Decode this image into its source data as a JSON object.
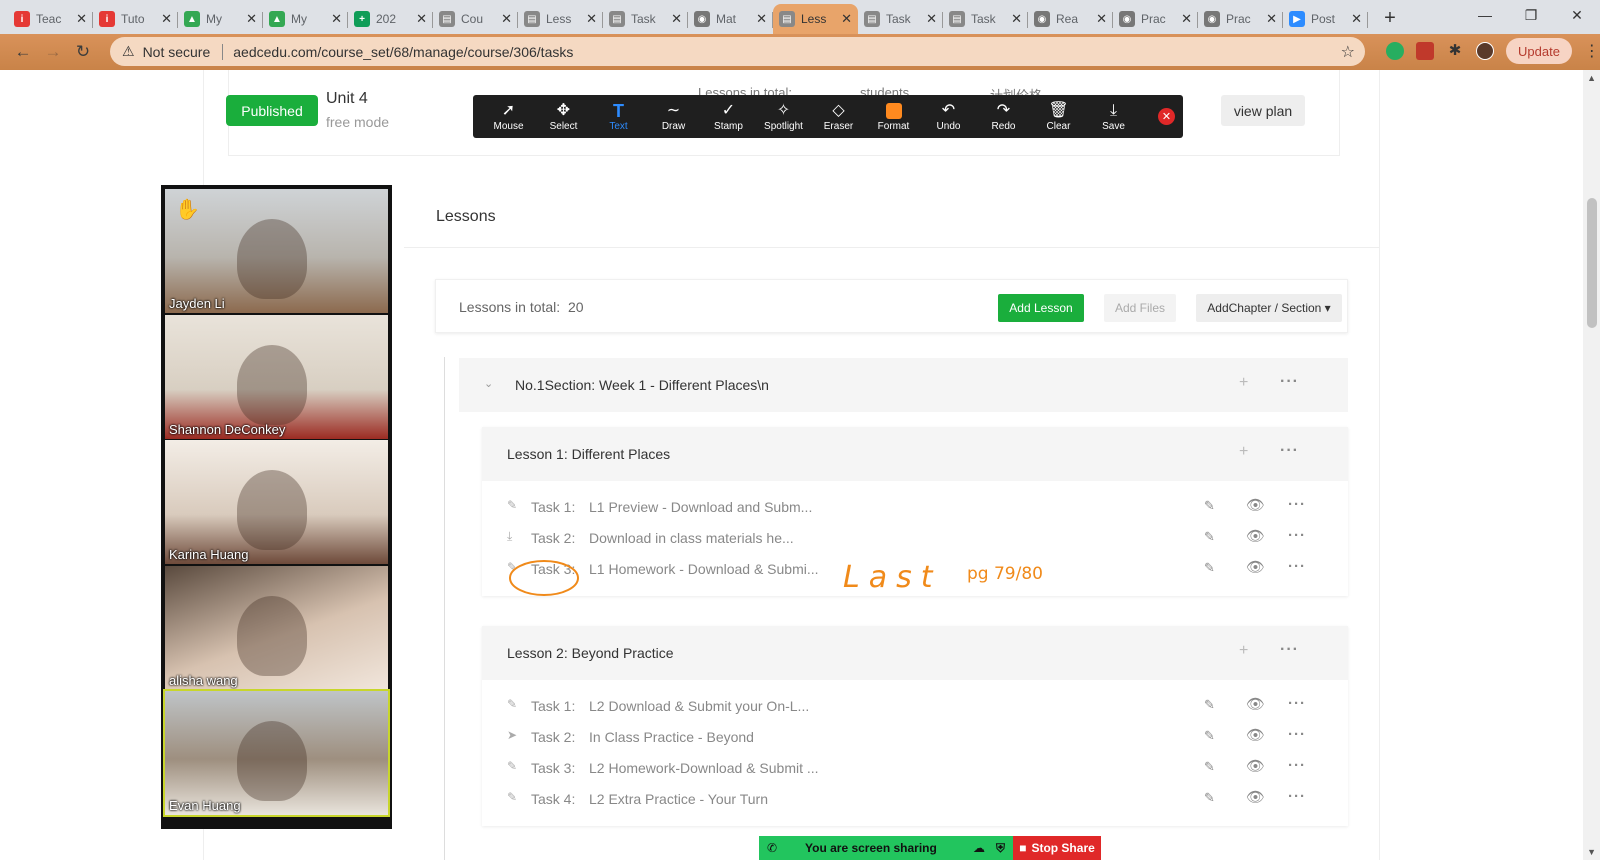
{
  "browser": {
    "tabs": [
      {
        "title": "Teac",
        "icon": "red-i-icon",
        "color": "#e53935"
      },
      {
        "title": "Tuto",
        "icon": "red-i-icon",
        "color": "#e53935"
      },
      {
        "title": "My",
        "icon": "google-drive-icon",
        "color": "#34a853"
      },
      {
        "title": "My",
        "icon": "google-drive-icon",
        "color": "#34a853"
      },
      {
        "title": "202",
        "icon": "google-sheets-icon",
        "color": "#0f9d58"
      },
      {
        "title": "Cou",
        "icon": "page-icon",
        "color": "#888888"
      },
      {
        "title": "Less",
        "icon": "page-icon",
        "color": "#888888"
      },
      {
        "title": "Task",
        "icon": "page-icon",
        "color": "#888888"
      },
      {
        "title": "Mat",
        "icon": "globe-icon",
        "color": "#777777"
      },
      {
        "title": "Less",
        "icon": "page-icon",
        "color": "#888888",
        "active": true
      },
      {
        "title": "Task",
        "icon": "page-icon",
        "color": "#888888"
      },
      {
        "title": "Task",
        "icon": "page-icon",
        "color": "#888888"
      },
      {
        "title": "Rea",
        "icon": "globe-icon",
        "color": "#777777"
      },
      {
        "title": "Prac",
        "icon": "globe-icon",
        "color": "#777777"
      },
      {
        "title": "Prac",
        "icon": "globe-icon",
        "color": "#777777"
      },
      {
        "title": "Post",
        "icon": "zoom-icon",
        "color": "#2d8cff"
      }
    ],
    "not_secure": "Not secure",
    "url": "aedcedu.com/course_set/68/manage/course/306/tasks",
    "update_label": "Update"
  },
  "zoom_toolbar": {
    "buttons": [
      "Mouse",
      "Select",
      "Text",
      "Draw",
      "Stamp",
      "Spotlight",
      "Eraser",
      "Format",
      "Undo",
      "Redo",
      "Clear",
      "Save"
    ],
    "active": "Text",
    "format_color": "#ff8a1f"
  },
  "course": {
    "status": "Published",
    "unit": "Unit 4",
    "mode": "free mode",
    "peek_labels": [
      "Lessons in total:",
      "students",
      "计划价格"
    ],
    "view_plan": "view plan"
  },
  "lessons": {
    "heading": "Lessons",
    "total_label": "Lessons in total:",
    "total_value": "20",
    "add_lesson": "Add Lesson",
    "add_files": "Add Files",
    "add_chapter": "AddChapter / Section ▾",
    "section_label": "No.1Section:  Week 1 - Different Places\\n",
    "items": [
      {
        "label": "Lesson 1:   Different Places",
        "tasks": [
          {
            "num": "Task 1:",
            "name": "L1 Preview - Download and Subm...",
            "icon": "pencil-icon"
          },
          {
            "num": "Task 2:",
            "name": "Download in class materials he...",
            "icon": "download-icon"
          },
          {
            "num": "Task 3:",
            "name": "L1 Homework - Download & Submi...",
            "icon": "pencil-icon",
            "highlighted": true
          }
        ]
      },
      {
        "label": "Lesson 2:   Beyond Practice",
        "tasks": [
          {
            "num": "Task 1:",
            "name": "L2 Download & Submit your On-L...",
            "icon": "pencil-icon"
          },
          {
            "num": "Task 2:",
            "name": "In Class Practice - Beyond",
            "icon": "send-icon"
          },
          {
            "num": "Task 3:",
            "name": "L2 Homework-Download & Submit ...",
            "icon": "pencil-icon"
          },
          {
            "num": "Task 4:",
            "name": "L2 Extra Practice - Your Turn",
            "icon": "pencil-icon"
          }
        ]
      }
    ]
  },
  "annotations": {
    "handwritten_1": "Last",
    "handwritten_2": "pg 79/80",
    "color": "#f08a1a"
  },
  "participants": [
    {
      "name": "Jayden Li",
      "raised_hand": true
    },
    {
      "name": "Shannon DeConkey"
    },
    {
      "name": "Karina Huang"
    },
    {
      "name": "alisha wang"
    },
    {
      "name": "Evan Huang",
      "active_speaker": true
    }
  ],
  "screen_share": {
    "status": "You are screen sharing",
    "stop_label": "Stop Share"
  }
}
